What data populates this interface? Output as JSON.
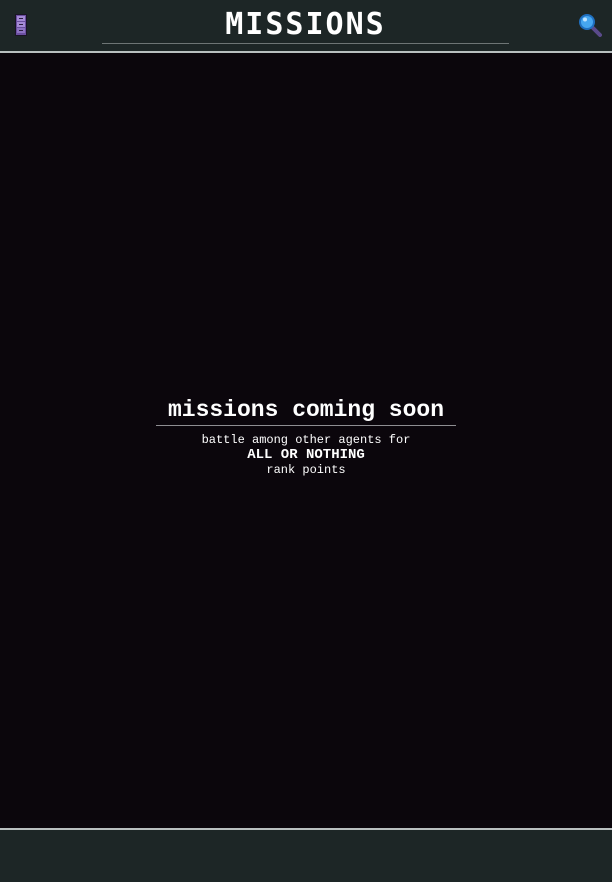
{
  "header": {
    "title": "MISSIONS",
    "menu_icon": "menu-icon",
    "search_icon": "search-icon"
  },
  "main": {
    "headline": "missions coming soon",
    "line1": "battle among other agents for",
    "line2": "ALL OR NOTHING",
    "line3": "rank points"
  },
  "colors": {
    "background": "#0b060c",
    "bar": "#1d2626",
    "divider": "#b9bfc0",
    "menu_icon_purple": "#5b3f8f",
    "search_icon_blue": "#2f86d6"
  }
}
